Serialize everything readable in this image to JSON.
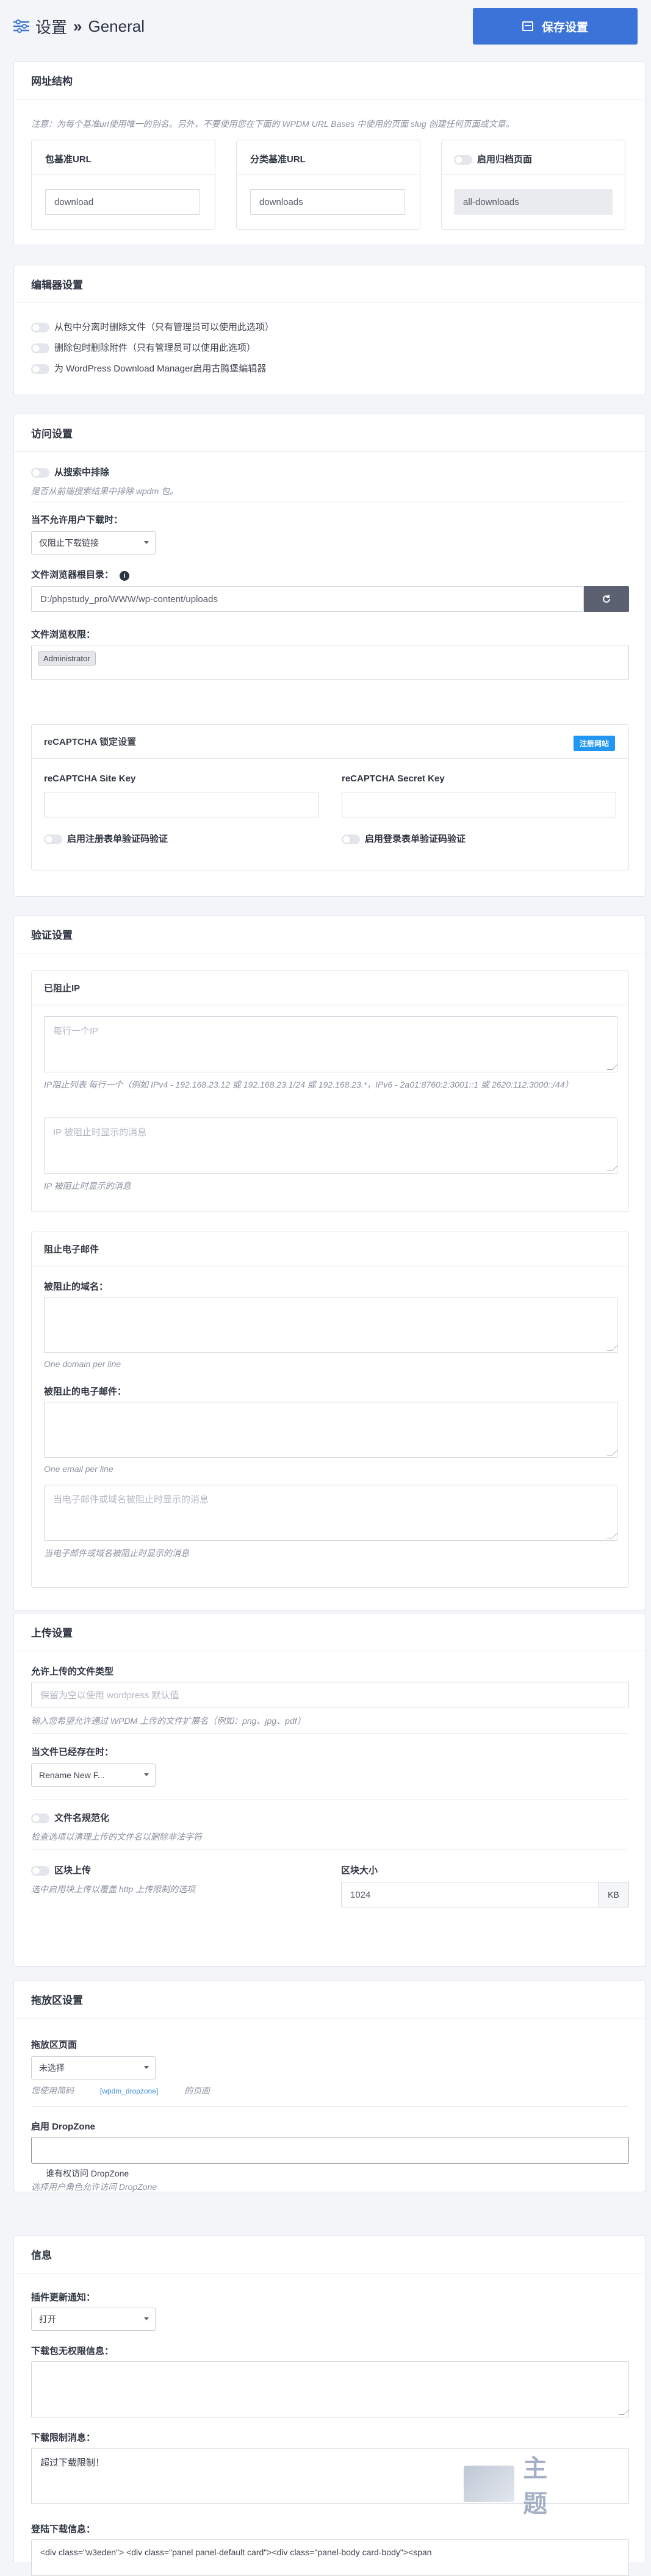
{
  "header": {
    "title": "设置",
    "breadcrumb_sep": "»",
    "subtitle": "General",
    "save": "保存设置"
  },
  "url": {
    "title": "网址结构",
    "note": "注意：为每个基准url使用唯一的别名。另外，不要使用您在下面的 WPDM URL Bases 中使用的页面 slug 创建任何页面或文章。",
    "pkg_label": "包基准URL",
    "pkg_value": "download",
    "cat_label": "分类基准URL",
    "cat_value": "downloads",
    "arch_label": "启用归档页面",
    "arch_value": "all-downloads"
  },
  "editor": {
    "title": "编辑器设置",
    "opt1": "从包中分离时删除文件（只有管理员可以使用此选项）",
    "opt2": "删除包时删除附件（只有管理员可以使用此选项）",
    "opt3": "为 WordPress Download Manager启用古腾堡编辑器"
  },
  "access": {
    "title": "访问设置",
    "exclude_label": "从搜索中排除",
    "exclude_note": "是否从前端搜索结果中排除 wpdm 包。",
    "deny_label": "当不允许用户下载时：",
    "deny_value": "仅阻止下载链接",
    "root_label": "文件浏览器根目录：",
    "root_value": "D:/phpstudy_pro/WWW/wp-content/uploads",
    "perm_label": "文件浏览权限：",
    "perm_tag": "Administrator",
    "recaptcha": {
      "title": "reCAPTCHA 锁定设置",
      "register": "注册网站",
      "site_key": "reCAPTCHA Site Key",
      "secret_key": "reCAPTCHA Secret Key",
      "reg_opt": "启用注册表单验证码验证",
      "login_opt": "启用登录表单验证码验证"
    }
  },
  "verify": {
    "title": "验证设置",
    "ip_title": "已阻止IP",
    "ip_ph": "每行一个IP",
    "ip_note": "IP阻止列表 每行一个（例如 IPv4 - 192.168.23.12 或 192.168.23.1/24 或 192.168.23.*，IPv6 - 2a01:8760:2:3001::1 或 2620:112:3000::/44）",
    "ip_msg_ph": "IP 被阻止时显示的消息",
    "ip_msg_note": "IP 被阻止时显示的消息",
    "email_title": "阻止电子邮件",
    "domain_label": "被阻止的域名：",
    "domain_note": "One domain per line",
    "email_label": "被阻止的电子邮件：",
    "email_note": "One email per line",
    "email_msg_ph": "当电子邮件或域名被阻止时显示的消息",
    "email_msg_note": "当电子邮件或域名被阻止时显示的消息"
  },
  "upload": {
    "title": "上传设置",
    "types_label": "允许上传的文件类型",
    "types_ph": "保留为空以使用 wordpress 默认值",
    "types_note": "输入您希望允许通过 WPDM 上传的文件扩展名（例如：png、jpg、pdf）",
    "exists_label": "当文件已经存在时：",
    "exists_value": "Rename New F...",
    "sanitize_label": "文件名规范化",
    "sanitize_note": "检查选项以清理上传的文件名以删除非法字符",
    "chunk_label": "区块上传",
    "chunk_note": "选中启用块上传以覆盖 http 上传限制的选项",
    "chunk_size_label": "区块大小",
    "chunk_size": "1024",
    "chunk_unit": "KB"
  },
  "dropzone": {
    "title": "拖放区设置",
    "page_label": "拖放区页面",
    "page_value": "未选择",
    "page_note_a": "您使用简码",
    "page_code": "[wpdm_dropzone]",
    "page_note_b": "的页面",
    "enable_label": "启用 DropZone",
    "enable_opt": "谁有权访问 DropZone",
    "enable_note": "选择用户角色允许访问 DropZone"
  },
  "info": {
    "title": "信息",
    "update_label": "插件更新通知：",
    "update_value": "打开",
    "noperm_label": "下载包无权限信息：",
    "limit_label": "下载限制消息：",
    "limit_value": "超过下载限制！",
    "login_label": "登陆下载信息：",
    "login_value": "<div class=\"w3eden\"> <div class=\"panel panel-default card\"><div class=\"panel-body card-body\"><span"
  },
  "watermark": "主题"
}
